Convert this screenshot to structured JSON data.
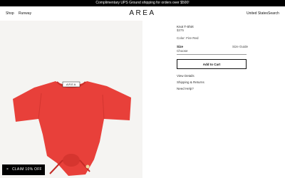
{
  "promo": {
    "text": "Complimentary UPS Ground shipping for orders over $500!"
  },
  "header": {
    "nav": [
      "Shop",
      "Runway"
    ],
    "logo": "AREA",
    "right": [
      "United States",
      "Search"
    ]
  },
  "product": {
    "image_label": "AREA",
    "title": "Knot T-Shirt",
    "price": "$375",
    "color": "Color: Fire Red",
    "size_label": "Size",
    "size_guide": "Size Guide",
    "select_placeholder": "Choose",
    "add_to_cart": "Add to Cart",
    "links": [
      "View Details",
      "Shipping & Returns",
      "Need Help?"
    ]
  },
  "promo_button": {
    "label": "CLAIM 10% OFF",
    "close": "×"
  },
  "colors": {
    "product": "#e8403a",
    "promo_bg": "#000000"
  }
}
